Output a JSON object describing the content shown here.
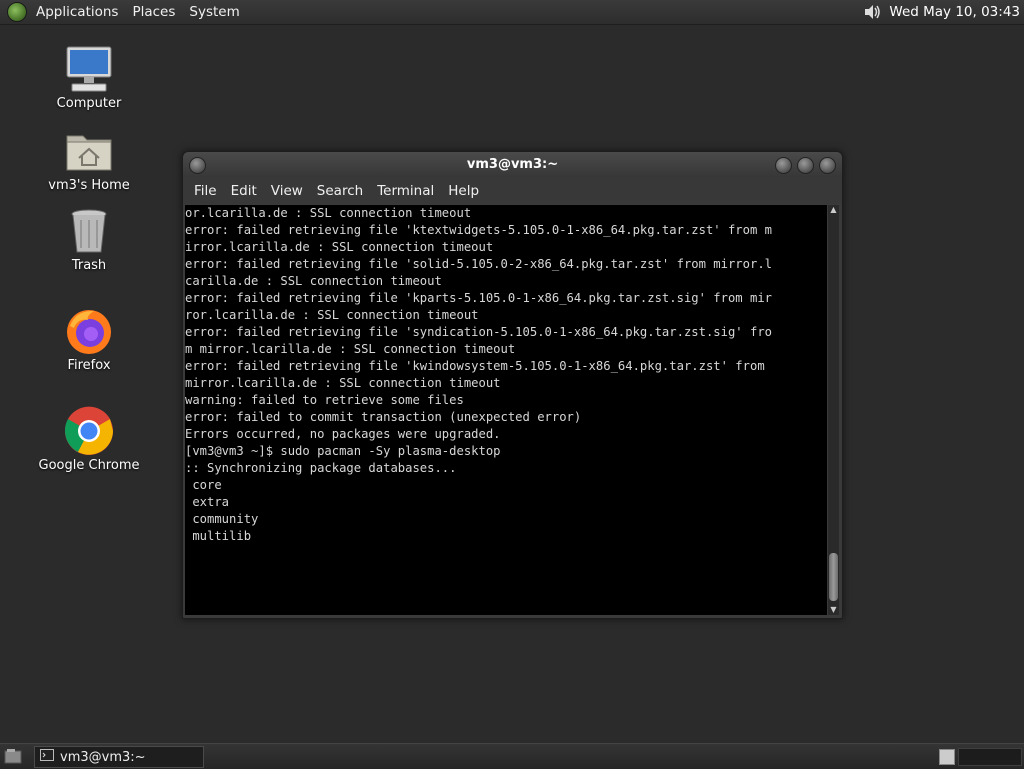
{
  "top_panel": {
    "menus": [
      "Applications",
      "Places",
      "System"
    ],
    "clock": "Wed May 10, 03:43"
  },
  "desktop": {
    "icons": [
      {
        "label": "Computer",
        "icon": "computer-icon"
      },
      {
        "label": "vm3's Home",
        "icon": "home-folder-icon"
      },
      {
        "label": "Trash",
        "icon": "trash-icon"
      },
      {
        "label": "Firefox",
        "icon": "firefox-icon"
      },
      {
        "label": "Google Chrome",
        "icon": "chrome-icon"
      }
    ]
  },
  "terminal": {
    "title": "vm3@vm3:~",
    "menus": [
      "File",
      "Edit",
      "View",
      "Search",
      "Terminal",
      "Help"
    ],
    "lines": [
      "or.lcarilla.de : SSL connection timeout",
      "error: failed retrieving file 'ktextwidgets-5.105.0-1-x86_64.pkg.tar.zst' from m",
      "irror.lcarilla.de : SSL connection timeout",
      "error: failed retrieving file 'solid-5.105.0-2-x86_64.pkg.tar.zst' from mirror.l",
      "carilla.de : SSL connection timeout",
      "error: failed retrieving file 'kparts-5.105.0-1-x86_64.pkg.tar.zst.sig' from mir",
      "ror.lcarilla.de : SSL connection timeout",
      "error: failed retrieving file 'syndication-5.105.0-1-x86_64.pkg.tar.zst.sig' fro",
      "m mirror.lcarilla.de : SSL connection timeout",
      "error: failed retrieving file 'kwindowsystem-5.105.0-1-x86_64.pkg.tar.zst' from ",
      "mirror.lcarilla.de : SSL connection timeout",
      "warning: failed to retrieve some files",
      "error: failed to commit transaction (unexpected error)",
      "Errors occurred, no packages were upgraded.",
      "[vm3@vm3 ~]$ sudo pacman -Sy plasma-desktop",
      ":: Synchronizing package databases...",
      " core",
      " extra",
      " community",
      " multilib"
    ]
  },
  "taskbar": {
    "task_label": "vm3@vm3:~"
  }
}
